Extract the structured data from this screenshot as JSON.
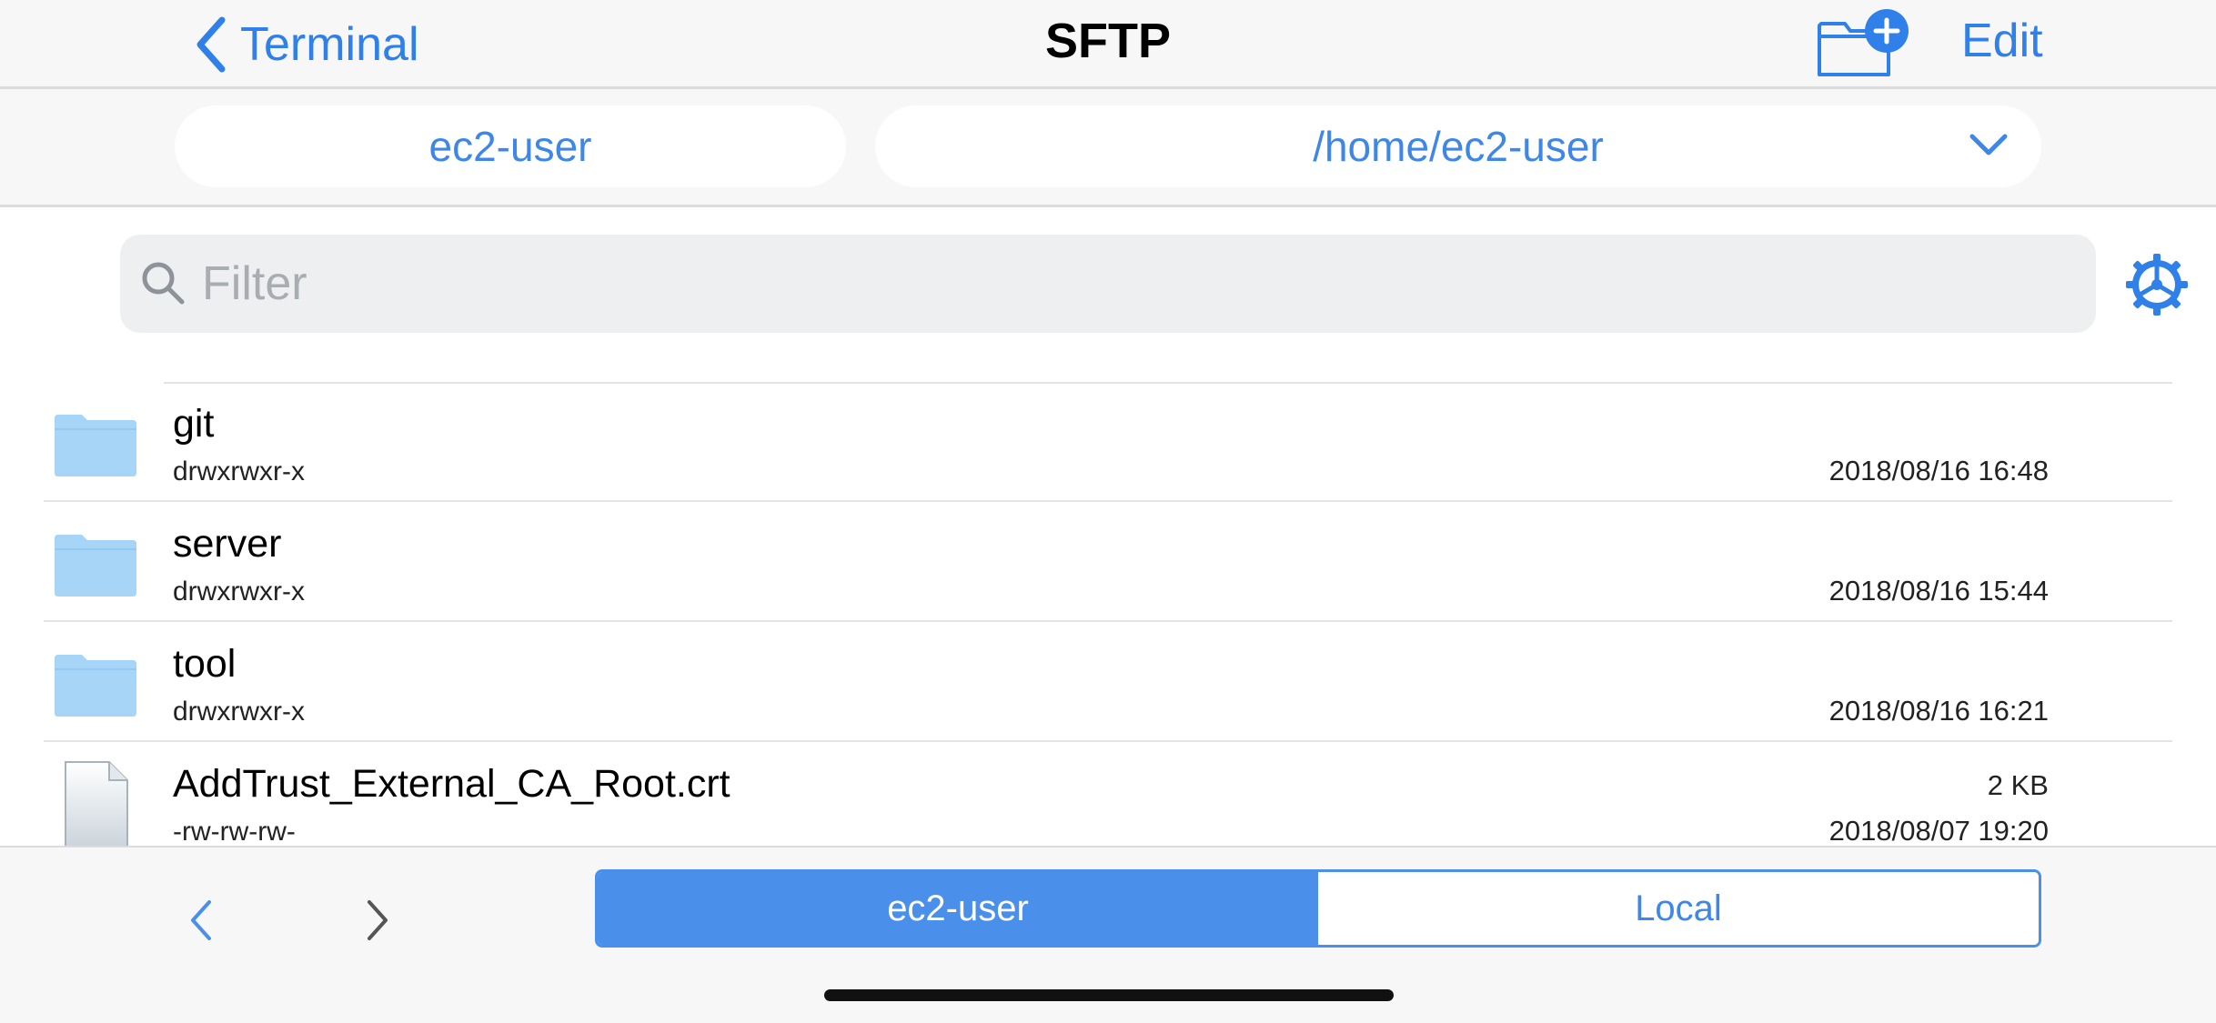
{
  "navbar": {
    "back_label": "Terminal",
    "title": "SFTP",
    "edit_label": "Edit",
    "new_folder_icon": "folder-plus-icon"
  },
  "pathbar": {
    "host": "ec2-user",
    "path": "/home/ec2-user"
  },
  "filter": {
    "placeholder": "Filter"
  },
  "files": [
    {
      "name": "git",
      "permissions": "drwxrwxr-x",
      "modified": "2018/08/16 16:48",
      "size": "",
      "type": "folder"
    },
    {
      "name": "server",
      "permissions": "drwxrwxr-x",
      "modified": "2018/08/16 15:44",
      "size": "",
      "type": "folder"
    },
    {
      "name": "tool",
      "permissions": "drwxrwxr-x",
      "modified": "2018/08/16 16:21",
      "size": "",
      "type": "folder"
    },
    {
      "name": "AddTrust_External_CA_Root.crt",
      "permissions": "-rw-rw-rw-",
      "modified": "2018/08/07 19:20",
      "size": "2 KB",
      "type": "file"
    }
  ],
  "toolbar": {
    "segments": [
      "ec2-user",
      "Local"
    ],
    "active_segment": "ec2-user"
  },
  "colors": {
    "accent": "#2f80e8",
    "folder": "#a6d5f7",
    "segment_active": "#4a8fea"
  }
}
